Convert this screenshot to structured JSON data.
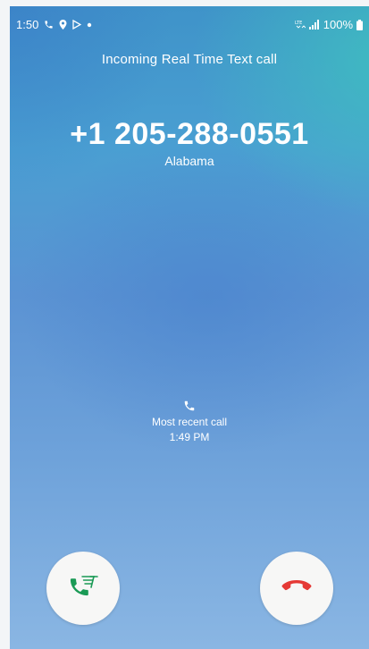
{
  "status_bar": {
    "time": "1:50",
    "network": "LTE",
    "battery": "100%",
    "icons": [
      "call-icon",
      "location-icon",
      "play-store-icon",
      "dot-icon",
      "lte-icon",
      "signal-icon",
      "battery-icon"
    ]
  },
  "call": {
    "title": "Incoming Real Time Text call",
    "number": "+1 205-288-0551",
    "location": "Alabama"
  },
  "recent_call": {
    "label": "Most recent call",
    "time": "1:49 PM"
  },
  "actions": {
    "accept": {
      "icon": "rtt-accept-icon",
      "color": "#1a9a55"
    },
    "decline": {
      "icon": "decline-call-icon",
      "color": "#e53935"
    }
  }
}
